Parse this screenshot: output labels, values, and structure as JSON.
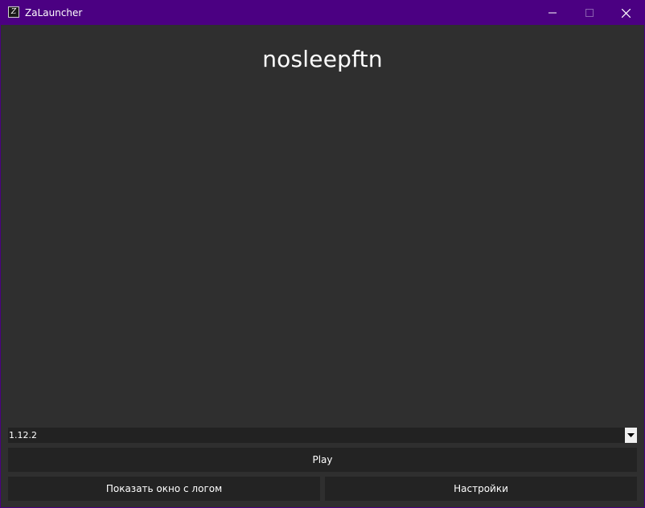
{
  "window": {
    "title": "ZaLauncher",
    "icon": "za-logo-icon",
    "controls": [
      "minimize-icon",
      "maximize-icon",
      "close-icon"
    ],
    "accent_color": "#4b0082"
  },
  "main": {
    "username": "nosleepftn"
  },
  "version_select": {
    "selected": "1.12.2"
  },
  "buttons": {
    "play": "Play",
    "show_log": "Показать окно с логом",
    "settings": "Настройки"
  },
  "colors": {
    "background": "#2f2f2f",
    "button": "#232323",
    "text": "#ffffff"
  }
}
